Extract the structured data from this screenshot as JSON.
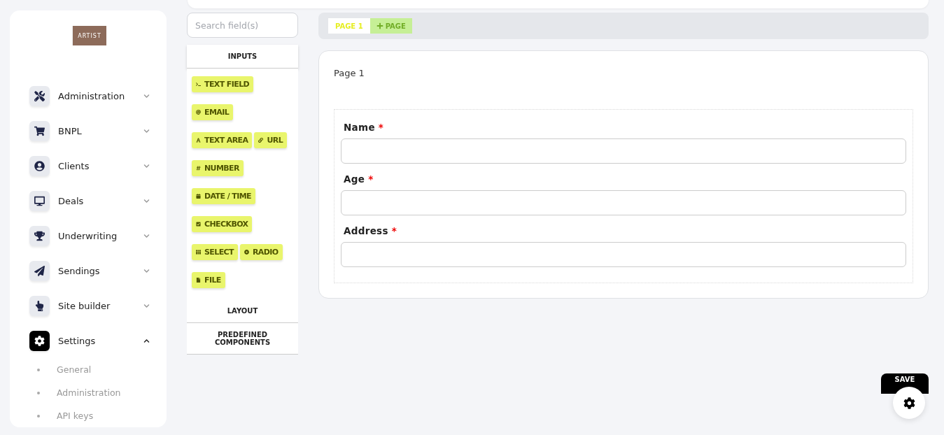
{
  "sidebar": {
    "logo": "ARTIST",
    "items": [
      {
        "label": "Administration",
        "expanded": false
      },
      {
        "label": "BNPL",
        "expanded": false
      },
      {
        "label": "Clients",
        "expanded": false
      },
      {
        "label": "Deals",
        "expanded": false
      },
      {
        "label": "Underwriting",
        "expanded": false
      },
      {
        "label": "Sendings",
        "expanded": false
      },
      {
        "label": "Site builder",
        "expanded": false
      },
      {
        "label": "Settings",
        "expanded": true,
        "children": [
          {
            "label": "General"
          },
          {
            "label": "Administration"
          },
          {
            "label": "API keys"
          }
        ]
      }
    ]
  },
  "palette": {
    "search": {
      "placeholder": "Search field(s)"
    },
    "sections": [
      {
        "title": "INPUTS",
        "rows": [
          [
            "TEXT FIELD"
          ],
          [
            "EMAIL"
          ],
          [
            "TEXT AREA",
            "URL"
          ],
          [
            "NUMBER"
          ],
          [
            "DATE / TIME"
          ],
          [
            "CHECKBOX"
          ],
          [
            "SELECT",
            "RADIO"
          ],
          [
            "FILE"
          ]
        ]
      },
      {
        "title": "LAYOUT"
      },
      {
        "title": "PREDEFINED COMPONENTS"
      }
    ]
  },
  "page_tabs": {
    "tabs": [
      {
        "label": "PAGE 1",
        "selected": true
      }
    ],
    "add_button": "PAGE"
  },
  "form": {
    "page_title": "Page 1",
    "fields": [
      {
        "label": "Name",
        "required_mark": "*"
      },
      {
        "label": "Age",
        "required_mark": "*"
      },
      {
        "label": "Address",
        "required_mark": "*"
      }
    ]
  },
  "save_button": "SAVE"
}
